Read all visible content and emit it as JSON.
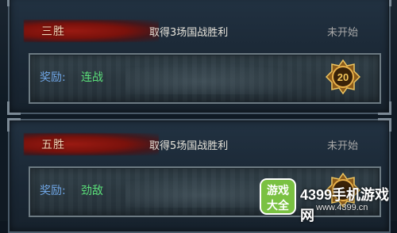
{
  "rows": [
    {
      "tier": "三胜",
      "task": "取得3场国战胜利",
      "status": "未开始",
      "reward_label": "奖励:",
      "reward_value": "连战",
      "medal_number": "20"
    },
    {
      "tier": "五胜",
      "task": "取得5场国战胜利",
      "status": "未开始",
      "reward_label": "奖励:",
      "reward_value": "劲敌"
    }
  ],
  "watermark": {
    "logo_text": "游戏大全",
    "brand": "4399手机游戏网",
    "url": "www.4399.cn"
  },
  "colors": {
    "tier_brush": "#8a140e",
    "reward_label": "#6fa6e6",
    "reward_value": "#5be07a",
    "status": "#a8a8a8",
    "medal_gold": "#d9a63a",
    "logo_green": "#7ac142"
  }
}
